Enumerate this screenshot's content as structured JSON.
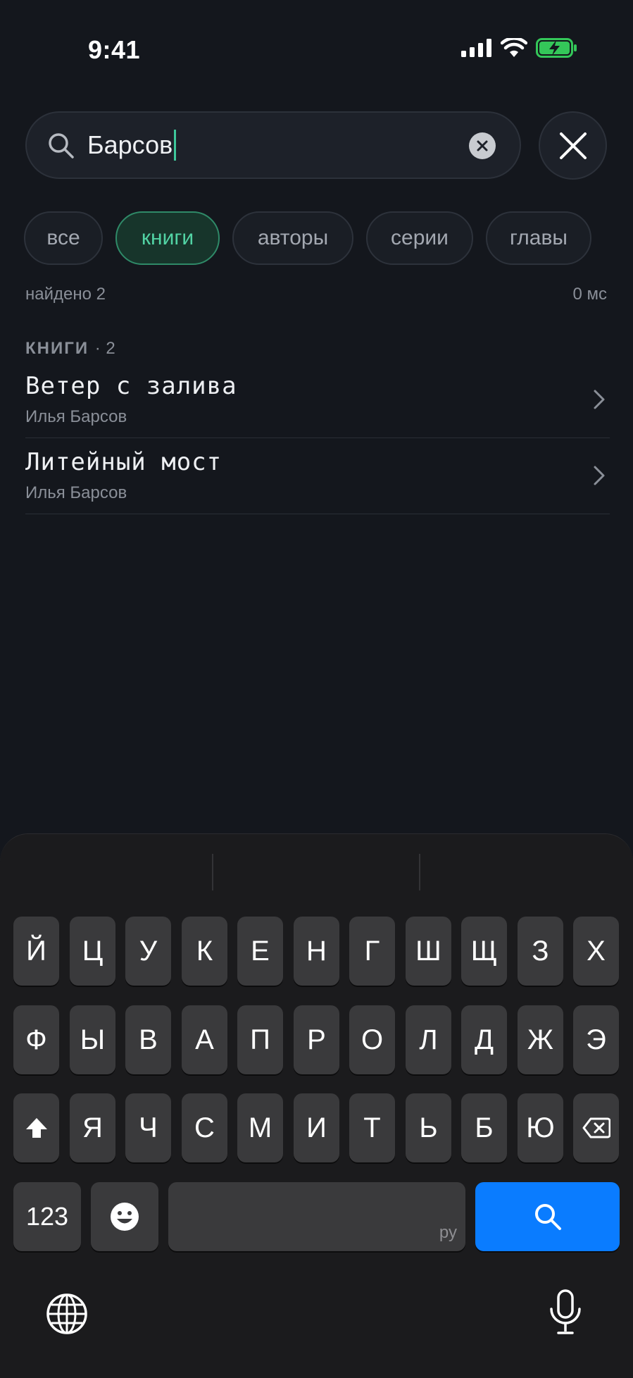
{
  "status_bar": {
    "time": "9:41"
  },
  "search": {
    "query": "Барсов"
  },
  "filters": [
    {
      "label": "все",
      "active": false
    },
    {
      "label": "книги",
      "active": true
    },
    {
      "label": "авторы",
      "active": false
    },
    {
      "label": "серии",
      "active": false
    },
    {
      "label": "главы",
      "active": false
    }
  ],
  "meta": {
    "found": "найдено 2",
    "duration": "0 мс"
  },
  "section": {
    "title": "КНИГИ",
    "count": "· 2"
  },
  "results": [
    {
      "title": "Ветер с залива",
      "author": "Илья Барсов"
    },
    {
      "title": "Литейный мост",
      "author": "Илья Барсов"
    }
  ],
  "keyboard": {
    "row1": [
      "Й",
      "Ц",
      "У",
      "К",
      "Е",
      "Н",
      "Г",
      "Ш",
      "Щ",
      "З",
      "Х"
    ],
    "row2": [
      "Ф",
      "Ы",
      "В",
      "А",
      "П",
      "Р",
      "О",
      "Л",
      "Д",
      "Ж",
      "Э"
    ],
    "row3": [
      "Я",
      "Ч",
      "С",
      "М",
      "И",
      "Т",
      "Ь",
      "Б",
      "Ю"
    ],
    "numbers_key": "123",
    "space_lang": "ру"
  },
  "colors": {
    "accent": "#52d3a4",
    "keyboard_action": "#0a7cff",
    "battery": "#34c759"
  }
}
